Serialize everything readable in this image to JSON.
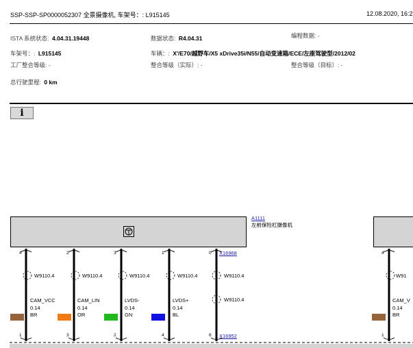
{
  "header": {
    "title": "SSP-SSP-SP0000052307 全景摄像机, 车架号：: L915145",
    "date": "12.08.2020, 16:2"
  },
  "info": {
    "ista_label": "ISTA 系统状态:",
    "ista_value": "4.04.31.19448",
    "data_label": "数据状态:",
    "data_value": "R4.04.31",
    "prog_label": "编程数据: -",
    "vin_label": "车架号：:",
    "vin_value": "L915145",
    "vehicle_label": "车辆：:",
    "vehicle_value": "X'/E70/越野车/X5 xDrive35i/N55/自动变速箱/ECE/左座驾驶型/2012/02",
    "factory_level": "工厂整合等级: -",
    "actual_level": "整合等级（实际）: -",
    "target_level": "整合等级（目标）: -",
    "mileage_label": "总行驶里程:",
    "mileage_value": "0 km"
  },
  "info_button": "i",
  "schematic": {
    "component_id": "A1111",
    "component_name": "左前保险杠摄像机",
    "connector_top": "X16968",
    "connector_bottom": "X16952",
    "pins": [
      {
        "top": "4",
        "bottom": "1",
        "wire": "W9110.4",
        "signal": "CAM_VCC",
        "size": "0.14",
        "color_code": "BR",
        "color": "#96643a"
      },
      {
        "top": "2",
        "bottom": "3",
        "wire": "W9110.4",
        "signal": "CAM_LIN",
        "size": "0.14",
        "color_code": "OR",
        "color": "#f07a14"
      },
      {
        "top": "3",
        "bottom": "2",
        "wire": "W9110.4",
        "signal": "LVDS-",
        "size": "0.14",
        "color_code": "GN",
        "color": "#22b822"
      },
      {
        "top": "1",
        "bottom": "4",
        "wire": "W9110.4",
        "signal": "LVDS+",
        "size": "0.14",
        "color_code": "BL",
        "color": "#1010e0"
      },
      {
        "top": "0",
        "bottom": "6",
        "wire": "W9110.4",
        "signal": "",
        "size": "",
        "color_code": "",
        "color": ""
      }
    ],
    "extra_wire": "W9110.4",
    "right_partial": {
      "pin_top": "4",
      "pin_bottom": "1",
      "wire": "W91",
      "signal": "CAM_V",
      "size": "0.14",
      "color_code": "BR",
      "color": "#96643a"
    }
  }
}
